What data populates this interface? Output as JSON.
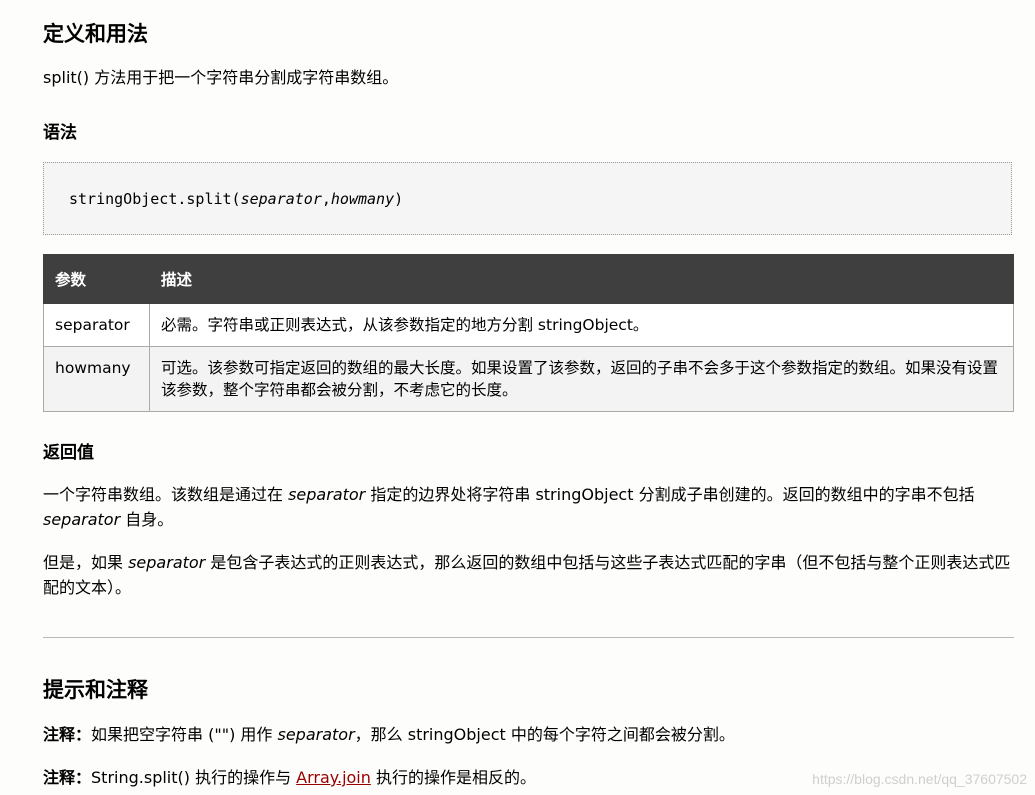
{
  "definition": {
    "heading": "定义和用法",
    "text": "split() 方法用于把一个字符串分割成字符串数组。"
  },
  "syntax": {
    "heading": "语法",
    "code_prefix": "stringObject.split(",
    "param1": "separator",
    "comma": ",",
    "param2": "howmany",
    "code_suffix": ")"
  },
  "params_table": {
    "headers": [
      "参数",
      "描述"
    ],
    "rows": [
      {
        "name": "separator",
        "desc": "必需。字符串或正则表达式，从该参数指定的地方分割 stringObject。"
      },
      {
        "name": "howmany",
        "desc": "可选。该参数可指定返回的数组的最大长度。如果设置了该参数，返回的子串不会多于这个参数指定的数组。如果没有设置该参数，整个字符串都会被分割，不考虑它的长度。"
      }
    ]
  },
  "return_value": {
    "heading": "返回值",
    "p1_a": "一个字符串数组。该数组是通过在 ",
    "p1_i1": "separator",
    "p1_b": " 指定的边界处将字符串 stringObject 分割成子串创建的。返回的数组中的字串不包括 ",
    "p1_i2": "separator",
    "p1_c": " 自身。",
    "p2_a": "但是，如果 ",
    "p2_i": "separator",
    "p2_b": " 是包含子表达式的正则表达式，那么返回的数组中包括与这些子表达式匹配的字串（但不包括与整个正则表达式匹配的文本）。"
  },
  "tips": {
    "heading": "提示和注释",
    "note_label": "注释：",
    "n1_a": "如果把空字符串 (\"\") 用作 ",
    "n1_i": "separator",
    "n1_b": "，那么 stringObject 中的每个字符之间都会被分割。",
    "n2_a": "String.split() 执行的操作与 ",
    "n2_link": "Array.join",
    "n2_b": " 执行的操作是相反的。"
  },
  "watermark": "https://blog.csdn.net/qq_37607502",
  "colors": {
    "table_header_bg": "#3f3f3f",
    "link": "#990000"
  }
}
